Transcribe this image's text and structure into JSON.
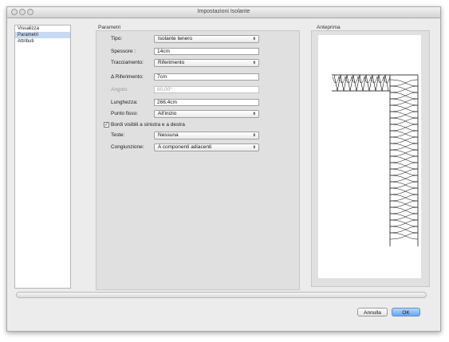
{
  "window": {
    "title": "Impostazioni Isolante"
  },
  "sidebar": {
    "items": [
      {
        "label": "Visualizza"
      },
      {
        "label": "Parametri"
      },
      {
        "label": "Attributi"
      }
    ],
    "selected": "Parametri"
  },
  "params": {
    "section_title": "Parametri",
    "tipo": {
      "label": "Tipo:",
      "value": "Isolante tenero"
    },
    "spessore": {
      "label": "Spessore :",
      "value": "14cm"
    },
    "tracciamento": {
      "label": "Tracciamento:",
      "value": "Riferimento"
    },
    "riferimento": {
      "label": "Δ Riferimento:",
      "value": "7cm"
    },
    "angolo": {
      "label": "Angolo:",
      "value": "60,00°"
    },
    "lunghezza": {
      "label": "Lunghezza:",
      "value": "266,4cm"
    },
    "punto_fisso": {
      "label": "Punto fisso:",
      "value": "All'inizio"
    },
    "bordi": {
      "label": "Bordi visibili a sinistra e a destra",
      "checked": true
    },
    "teste": {
      "label": "Teste:",
      "value": "Nessuna"
    },
    "congiunzione": {
      "label": "Congiunzione:",
      "value": "A componenti adiacenti"
    }
  },
  "preview": {
    "title": "Anteprima"
  },
  "buttons": {
    "cancel": "Annulla",
    "ok": "OK"
  },
  "colors": {
    "accent": "#6aa6f0",
    "selection": "#c8d9f2"
  }
}
